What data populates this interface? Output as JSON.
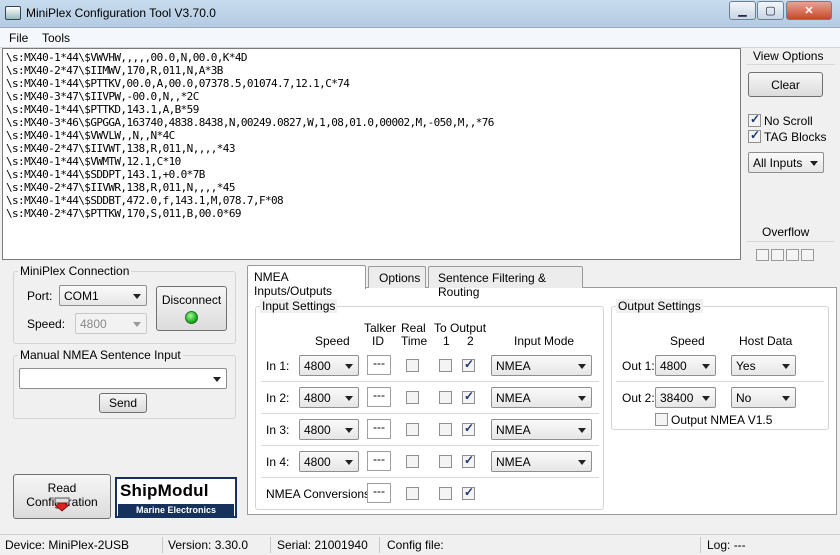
{
  "window": {
    "title": "MiniPlex Configuration Tool V3.70.0"
  },
  "menu": {
    "file": "File",
    "tools": "Tools"
  },
  "terminal": {
    "lines": [
      "\\s:MX40-1*44\\$VWVHW,,,,,00.0,N,00.0,K*4D",
      "\\s:MX40-2*47\\$IIMWV,170,R,011,N,A*3B",
      "\\s:MX40-1*44\\$PTTKV,00.0,A,00.0,07378.5,01074.7,12.1,C*74",
      "\\s:MX40-3*47\\$IIVPW,-00.0,N,,*2C",
      "\\s:MX40-1*44\\$PTTKD,143.1,A,B*59",
      "\\s:MX40-3*46\\$GPGGA,163740,4838.8438,N,00249.0827,W,1,08,01.0,00002,M,-050,M,,*76",
      "\\s:MX40-1*44\\$VWVLW,,N,,N*4C",
      "\\s:MX40-2*47\\$IIVWT,138,R,011,N,,,,*43",
      "\\s:MX40-1*44\\$VWMTW,12.1,C*10",
      "\\s:MX40-1*44\\$SDDPT,143.1,+0.0*7B",
      "\\s:MX40-2*47\\$IIVWR,138,R,011,N,,,,*45",
      "\\s:MX40-1*44\\$SDDBT,472.0,f,143.1,M,078.7,F*08",
      "\\s:MX40-2*47\\$PTTKW,170,S,011,B,00.0*69"
    ]
  },
  "view_options": {
    "title": "View Options",
    "clear": "Clear",
    "no_scroll": "No Scroll",
    "tag_blocks": "TAG Blocks",
    "filter": "All Inputs",
    "overflow": "Overflow"
  },
  "connection": {
    "title": "MiniPlex Connection",
    "port_label": "Port:",
    "port": "COM1",
    "speed_label": "Speed:",
    "speed": "4800",
    "disconnect": "Disconnect"
  },
  "manual": {
    "title": "Manual NMEA Sentence Input",
    "value": "",
    "send": "Send"
  },
  "read_config": "Read Configuration",
  "logo": {
    "name": "ShipModul",
    "tagline": "Marine Electronics"
  },
  "tabs": [
    "NMEA Inputs/Outputs",
    "Options",
    "Sentence Filtering & Routing"
  ],
  "inputs": {
    "title": "Input Settings",
    "headers": {
      "speed": "Speed",
      "talker_1": "Talker",
      "talker_2": "ID",
      "real_1": "Real",
      "real_2": "Time",
      "to_output": "To Output",
      "out1": "1",
      "out2": "2",
      "mode": "Input Mode"
    },
    "rows": [
      {
        "label": "In 1:",
        "speed": "4800",
        "talker": "---",
        "mode": "NMEA"
      },
      {
        "label": "In 2:",
        "speed": "4800",
        "talker": "---",
        "mode": "NMEA"
      },
      {
        "label": "In 3:",
        "speed": "4800",
        "talker": "---",
        "mode": "NMEA"
      },
      {
        "label": "In 4:",
        "speed": "4800",
        "talker": "---",
        "mode": "NMEA"
      }
    ],
    "conversions_label": "NMEA Conversions:",
    "conversions_talker": "---"
  },
  "outputs": {
    "title": "Output Settings",
    "speed_header": "Speed",
    "host_header": "Host Data",
    "rows": [
      {
        "label": "Out 1:",
        "speed": "4800",
        "host": "Yes"
      },
      {
        "label": "Out 2:",
        "speed": "38400",
        "host": "No"
      }
    ],
    "v15": "Output NMEA V1.5"
  },
  "status": {
    "device": "Device: MiniPlex-2USB",
    "version": "Version: 3.30.0",
    "serial": "Serial: 21001940",
    "config": "Config file:",
    "log": "Log: ---"
  }
}
